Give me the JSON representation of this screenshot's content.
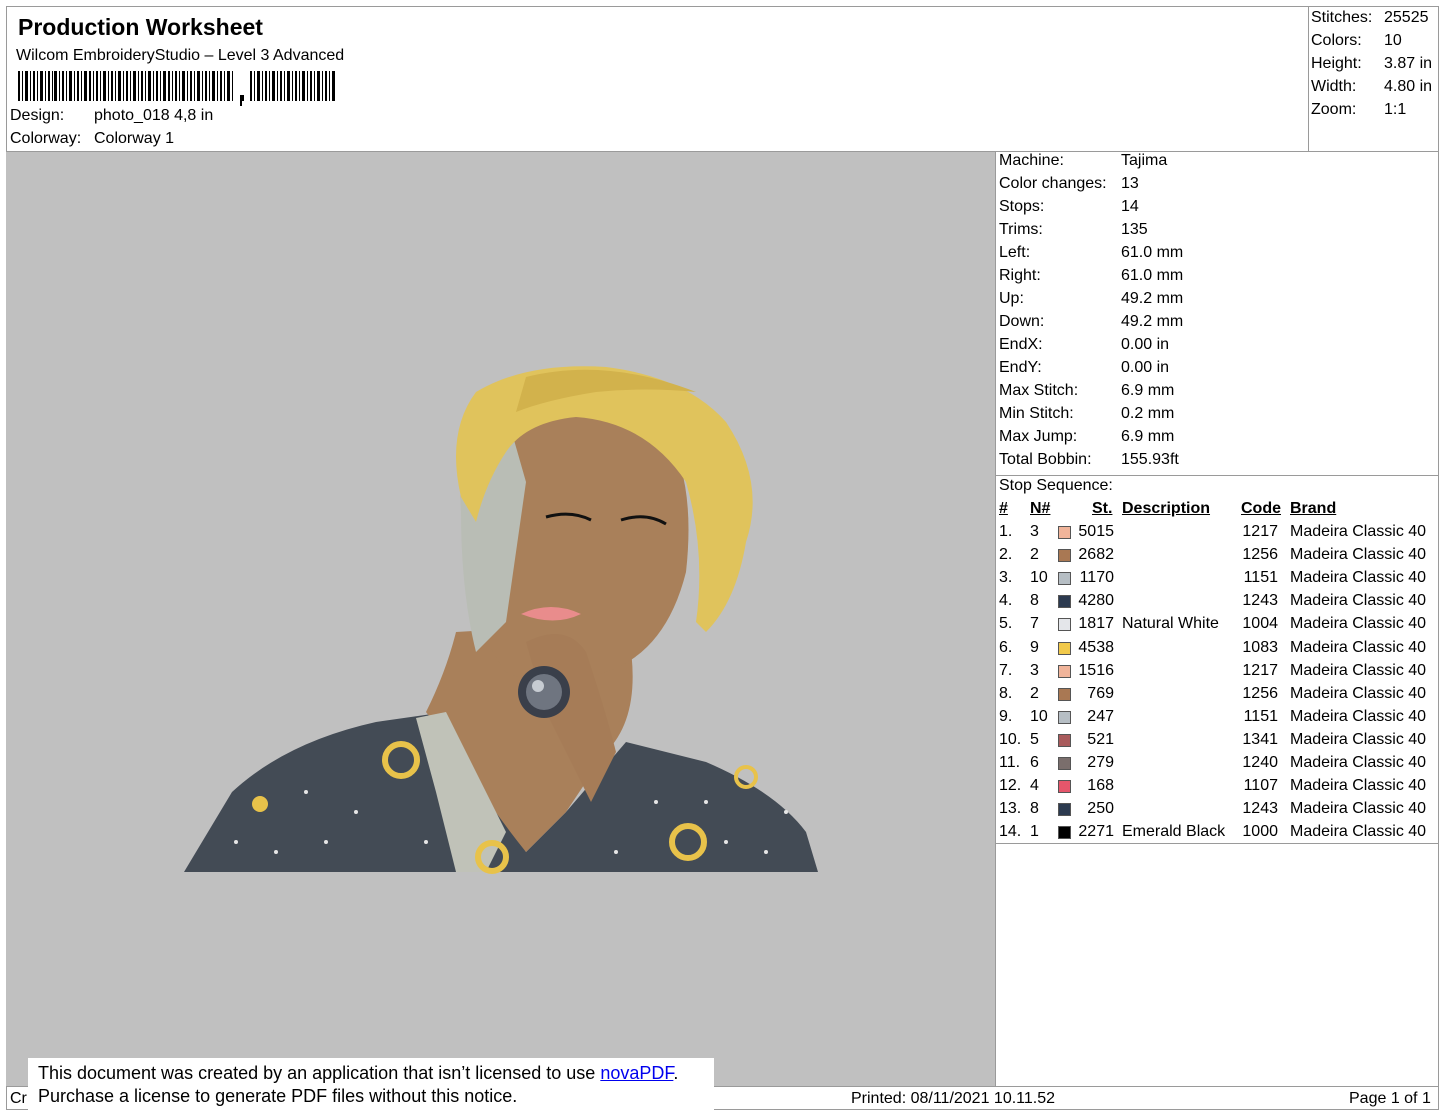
{
  "header": {
    "title": "Production Worksheet",
    "subtitle": "Wilcom EmbroideryStudio – Level 3 Advanced",
    "design_label": "Design:",
    "design_value": "photo_018 4,8 in",
    "colorway_label": "Colorway:",
    "colorway_value": "Colorway 1"
  },
  "stats": [
    {
      "label": "Stitches:",
      "value": "25525"
    },
    {
      "label": "Colors:",
      "value": "10"
    },
    {
      "label": "Height:",
      "value": "3.87 in"
    },
    {
      "label": "Width:",
      "value": "4.80 in"
    },
    {
      "label": "Zoom:",
      "value": "1:1"
    }
  ],
  "machine_info": [
    {
      "label": "Machine:",
      "value": "Tajima"
    },
    {
      "label": "Color changes:",
      "value": "13"
    },
    {
      "label": "Stops:",
      "value": "14"
    },
    {
      "label": "Trims:",
      "value": "135"
    },
    {
      "label": "Left:",
      "value": "61.0 mm"
    },
    {
      "label": "Right:",
      "value": "61.0 mm"
    },
    {
      "label": "Up:",
      "value": "49.2 mm"
    },
    {
      "label": "Down:",
      "value": "49.2 mm"
    },
    {
      "label": "EndX:",
      "value": "0.00 in"
    },
    {
      "label": "EndY:",
      "value": "0.00 in"
    },
    {
      "label": "Max Stitch:",
      "value": "6.9 mm"
    },
    {
      "label": "Min Stitch:",
      "value": "0.2 mm"
    },
    {
      "label": "Max Jump:",
      "value": "6.9 mm"
    },
    {
      "label": "Total Bobbin:",
      "value": "155.93ft"
    }
  ],
  "stop_sequence": {
    "title": "Stop Sequence:",
    "columns": {
      "num": "#",
      "needle": "N#",
      "stitches": "St.",
      "description": "Description",
      "code": "Code",
      "brand": "Brand"
    },
    "rows": [
      {
        "num": "1.",
        "needle": "3",
        "color": "#f0b49a",
        "stitches": "5015",
        "description": "",
        "code": "1217",
        "brand": "Madeira Classic 40"
      },
      {
        "num": "2.",
        "needle": "2",
        "color": "#a97853",
        "stitches": "2682",
        "description": "",
        "code": "1256",
        "brand": "Madeira Classic 40"
      },
      {
        "num": "3.",
        "needle": "10",
        "color": "#b6bec4",
        "stitches": "1170",
        "description": "",
        "code": "1151",
        "brand": "Madeira Classic 40"
      },
      {
        "num": "4.",
        "needle": "8",
        "color": "#2c3a4f",
        "stitches": "4280",
        "description": "",
        "code": "1243",
        "brand": "Madeira Classic 40"
      },
      {
        "num": "5.",
        "needle": "7",
        "color": "#e4e6ea",
        "stitches": "1817",
        "description": "Natural White",
        "code": "1004",
        "brand": "Madeira Classic 40"
      },
      {
        "num": "6.",
        "needle": "9",
        "color": "#f1c94a",
        "stitches": "4538",
        "description": "",
        "code": "1083",
        "brand": "Madeira Classic 40"
      },
      {
        "num": "7.",
        "needle": "3",
        "color": "#f0b49a",
        "stitches": "1516",
        "description": "",
        "code": "1217",
        "brand": "Madeira Classic 40"
      },
      {
        "num": "8.",
        "needle": "2",
        "color": "#a97853",
        "stitches": "769",
        "description": "",
        "code": "1256",
        "brand": "Madeira Classic 40"
      },
      {
        "num": "9.",
        "needle": "10",
        "color": "#b6bec4",
        "stitches": "247",
        "description": "",
        "code": "1151",
        "brand": "Madeira Classic 40"
      },
      {
        "num": "10.",
        "needle": "5",
        "color": "#a95b5c",
        "stitches": "521",
        "description": "",
        "code": "1341",
        "brand": "Madeira Classic 40"
      },
      {
        "num": "11.",
        "needle": "6",
        "color": "#7a6e6c",
        "stitches": "279",
        "description": "",
        "code": "1240",
        "brand": "Madeira Classic 40"
      },
      {
        "num": "12.",
        "needle": "4",
        "color": "#e5566b",
        "stitches": "168",
        "description": "",
        "code": "1107",
        "brand": "Madeira Classic 40"
      },
      {
        "num": "13.",
        "needle": "8",
        "color": "#2c3a4f",
        "stitches": "250",
        "description": "",
        "code": "1243",
        "brand": "Madeira Classic 40"
      },
      {
        "num": "14.",
        "needle": "1",
        "color": "#000000",
        "stitches": "2271",
        "description": "Emerald Black",
        "code": "1000",
        "brand": "Madeira Classic 40"
      }
    ]
  },
  "footer": {
    "left_fragment": "Cr",
    "printed": "Printed: 08/11/2021 10.11.52",
    "page": "Page 1 of 1"
  },
  "notice": {
    "line1_prefix": "This document was created by an application that isn’t licensed to use ",
    "link": "novaPDF",
    "line1_suffix": ".",
    "line2": "Purchase a license to generate PDF files without this notice."
  }
}
